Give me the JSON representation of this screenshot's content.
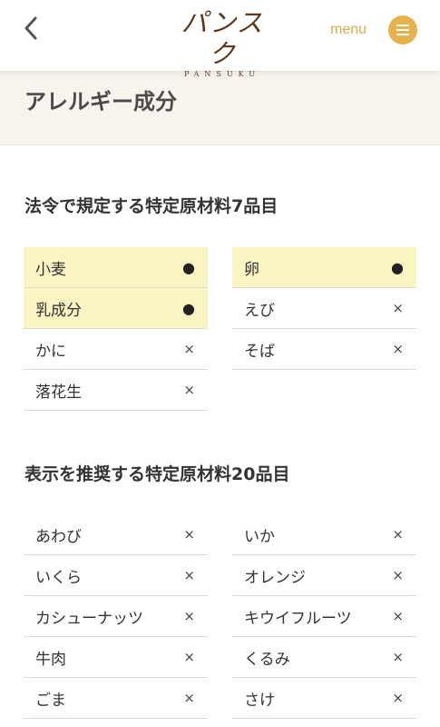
{
  "header": {
    "logo_main": "パンスク",
    "logo_sub": "PANSUKU",
    "menu_label": "menu",
    "back_icon": "chevron-left-icon",
    "menu_icon": "hamburger-icon",
    "accent_color": "#e5b24e"
  },
  "page": {
    "title": "アレルギー成分"
  },
  "sections": [
    {
      "heading": "法令で規定する特定原材料7品目",
      "items": [
        {
          "name": "小麦",
          "mark": "●",
          "highlighted": true
        },
        {
          "name": "卵",
          "mark": "●",
          "highlighted": true
        },
        {
          "name": "乳成分",
          "mark": "●",
          "highlighted": true
        },
        {
          "name": "えび",
          "mark": "×",
          "highlighted": false
        },
        {
          "name": "かに",
          "mark": "×",
          "highlighted": false
        },
        {
          "name": "そば",
          "mark": "×",
          "highlighted": false
        },
        {
          "name": "落花生",
          "mark": "×",
          "highlighted": false
        }
      ]
    },
    {
      "heading": "表示を推奨する特定原材料20品目",
      "items": [
        {
          "name": "あわび",
          "mark": "×",
          "highlighted": false
        },
        {
          "name": "いか",
          "mark": "×",
          "highlighted": false
        },
        {
          "name": "いくら",
          "mark": "×",
          "highlighted": false
        },
        {
          "name": "オレンジ",
          "mark": "×",
          "highlighted": false
        },
        {
          "name": "カシューナッツ",
          "mark": "×",
          "highlighted": false
        },
        {
          "name": "キウイフルーツ",
          "mark": "×",
          "highlighted": false
        },
        {
          "name": "牛肉",
          "mark": "×",
          "highlighted": false
        },
        {
          "name": "くるみ",
          "mark": "×",
          "highlighted": false
        },
        {
          "name": "ごま",
          "mark": "×",
          "highlighted": false
        },
        {
          "name": "さけ",
          "mark": "×",
          "highlighted": false
        }
      ]
    }
  ]
}
